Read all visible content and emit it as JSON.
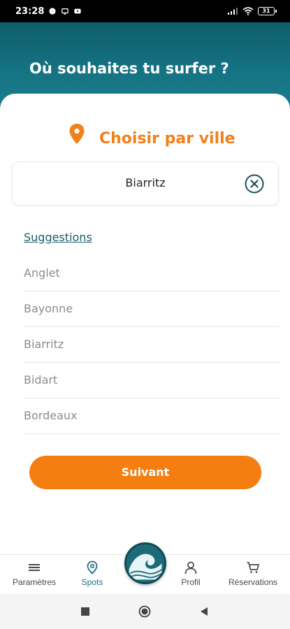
{
  "status_bar": {
    "time": "23:28",
    "battery": "31",
    "icons": [
      "messenger-icon",
      "screen-icon",
      "youtube-icon",
      "signal-icon",
      "wifi-icon",
      "battery-icon"
    ]
  },
  "header": {
    "title": "Où souhaites tu surfer ?"
  },
  "picker": {
    "title": "Choisir par ville",
    "icon": "location-pin-icon",
    "accent": "#f2801b"
  },
  "search": {
    "value": "Biarritz"
  },
  "suggestions": {
    "label": "Suggestions",
    "items": [
      "Anglet",
      "Bayonne",
      "Biarritz",
      "Bidart",
      "Bordeaux"
    ]
  },
  "next_button": {
    "label": "Suivant",
    "color": "#f47e10"
  },
  "bottom_nav": {
    "items": [
      {
        "label": "Paramètres",
        "icon": "menu-icon"
      },
      {
        "label": "Spots",
        "icon": "location-pin-icon",
        "active": true
      },
      {
        "label": "Profil",
        "icon": "person-icon"
      },
      {
        "label": "Réservations",
        "icon": "cart-icon"
      }
    ],
    "center_icon": "wave-logo-icon",
    "active_color": "#1a6f7f"
  },
  "system_nav": {
    "icons": [
      "recents-icon",
      "home-icon",
      "back-icon"
    ]
  }
}
